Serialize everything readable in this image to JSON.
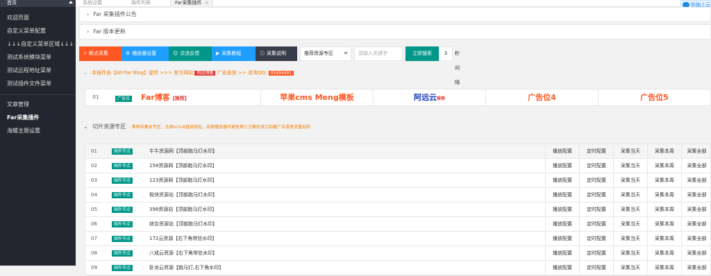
{
  "sidebar": {
    "top_label": "首页",
    "items": [
      {
        "label": "欢迎页面"
      },
      {
        "label": "自定义菜单配置"
      },
      {
        "label": "↓↓↓自定义菜单区域↓↓↓"
      },
      {
        "label": "测试系统模块菜单"
      },
      {
        "label": "测试远程地址菜单"
      },
      {
        "label": "测试插件文件菜单"
      }
    ],
    "items2": [
      {
        "label": "文章管理"
      },
      {
        "label": "Far采集插件"
      },
      {
        "label": "海螺主题设置"
      }
    ]
  },
  "tabs": [
    {
      "label": "系统设置"
    },
    {
      "label": "插件列表"
    },
    {
      "label": "Far采集插件",
      "close": "×"
    }
  ],
  "corner_badge": "防抽上云",
  "collapse": {
    "announce": "Far 采集插件公告",
    "update": "Far 版本更新"
  },
  "toolbar": {
    "btn1": "断点采集",
    "btn2": "播放器设置",
    "btn3": "交流反馈",
    "btn4": "采集教程",
    "btn5": "采集说明",
    "select": "推荐资源专区",
    "search_placeholder": "请输入关键字",
    "search_btn": "立即搜索",
    "interval_value": "3",
    "interval_label": "秒间隔",
    "colors": {
      "btn1": "#ff5722",
      "btn2": "#1e9fff",
      "btn3": "#009688",
      "btn4": "#1e9fff",
      "btn5": "#393d49"
    }
  },
  "notice": {
    "prefix": "本插件由【Ah*far Blog】提供 >>> 官方网站",
    "site": "阿远博客",
    "mid": "广告投放 >> 咨询QQ:",
    "qq": "45494491"
  },
  "ads": {
    "index": "01",
    "badge": "广告位",
    "cells": [
      {
        "main": "Far博客",
        "sub": "【推荐】",
        "color": "#ff5722"
      },
      {
        "main": "苹果cms Meng模板",
        "sub": "",
        "color": "#ff5722"
      },
      {
        "main": "阿远云",
        "sub": "推荐",
        "color": "#1e3ebf"
      },
      {
        "main": "广告位4",
        "sub": "",
        "color": "#ff5722"
      },
      {
        "main": "广告位5",
        "sub": "",
        "color": "#ff5722"
      }
    ]
  },
  "section": {
    "title": "切片资源专区",
    "hint": "推荐采集本专区，全部m3u8直链地址，自建播放器可避免第三方解析接口加载广告或者流量劫持"
  },
  "table": {
    "tag": "国外节点",
    "actions": [
      "播放配置",
      "定时配置",
      "采集当天",
      "采集本周",
      "采集全部"
    ],
    "rows": [
      {
        "idx": "01",
        "name": "牛牛资源网【顶部跑马灯水印】"
      },
      {
        "idx": "02",
        "name": "158资源网【顶部跑马灯水印】"
      },
      {
        "idx": "03",
        "name": "123资源网【顶部跑马灯水印】"
      },
      {
        "idx": "04",
        "name": "极快资源站【顶部跑马灯水印】"
      },
      {
        "idx": "05",
        "name": "398资源站【顶部跑马灯水印】"
      },
      {
        "idx": "06",
        "name": "综合资源站【顶部跑马灯水印】"
      },
      {
        "idx": "07",
        "name": "172云资源【右下角常驻水印】"
      },
      {
        "idx": "08",
        "name": "八戒云资源【右下角常驻水印】"
      },
      {
        "idx": "09",
        "name": "卧龙云资源【跑马灯,右下角水印】"
      }
    ]
  }
}
